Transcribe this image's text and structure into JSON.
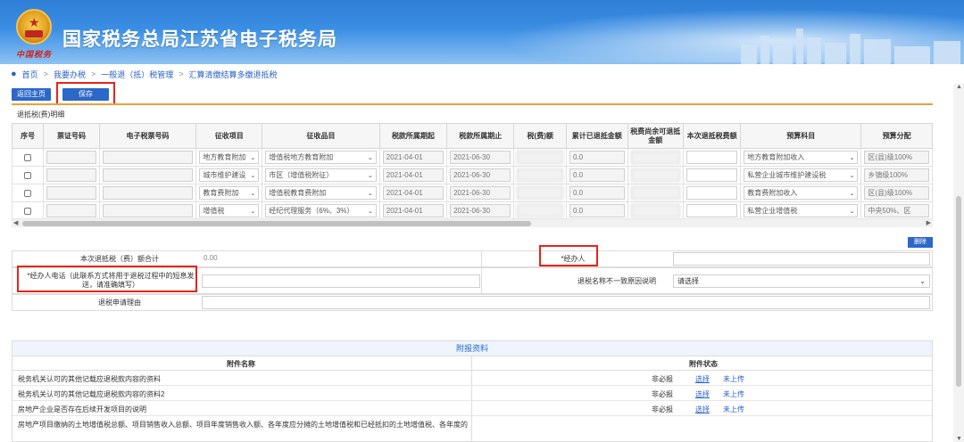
{
  "header": {
    "site_title": "国家税务总局江苏省电子税务局",
    "emblem_caption": "中国税务"
  },
  "breadcrumb": {
    "items": [
      "首页",
      "我要办税",
      "一般退（抵）税管理",
      "汇算清缴结算多缴退抵税"
    ],
    "separator": ">"
  },
  "toolbar": {
    "home_label": "返回主页",
    "save_label": "保存"
  },
  "refund_table": {
    "section_title": "退抵税(费)明细",
    "columns": [
      "序号",
      "票证号码",
      "电子税票号码",
      "征收项目",
      "征收品目",
      "税款所属期起",
      "税款所属期止",
      "税(费)额",
      "累计已退抵金额",
      "税费尚余可退抵金额",
      "本次退抵税费额",
      "预算科目",
      "预算分配"
    ],
    "rows": [
      {
        "item": "地方教育附加",
        "subitem": "增值税地方教育附加",
        "start": "2021-04-01",
        "end": "2021-06-30",
        "refunded": "0.0",
        "budget": "地方教育附加收入",
        "alloc": "区(县)级100%"
      },
      {
        "item": "城市维护建设",
        "subitem": "市区（增值税附征）",
        "start": "2021-04-01",
        "end": "2021-06-30",
        "refunded": "0.0",
        "budget": "私营企业城市维护建设税",
        "alloc": "乡镇级100%"
      },
      {
        "item": "教育费附加",
        "subitem": "增值税教育费附加",
        "start": "2021-04-01",
        "end": "2021-06-30",
        "refunded": "0.0",
        "budget": "教育费附加收入",
        "alloc": "区(县)级100%"
      },
      {
        "item": "增值税",
        "subitem": "经纪代理服务（6%、3%）",
        "start": "2021-04-01",
        "end": "2021-06-30",
        "refunded": "0.0",
        "budget": "私营企业增值税",
        "alloc": "中央50%、区"
      }
    ]
  },
  "delete_label": "删除",
  "form": {
    "total_label": "本次退抵税（费）额合计",
    "total_value": "0.00",
    "handler_label": "*经办人",
    "phone_label": "*经办人电话（此联系方式将用于退税过程中的短息发送，请准确填写）",
    "name_mismatch_label": "退税名称不一致原因说明",
    "name_mismatch_value": "请选择",
    "reason_label": "退税申请理由"
  },
  "attachments": {
    "title": "附报资料",
    "col_name": "附件名称",
    "col_status": "附件状态",
    "rows": [
      {
        "name": "税务机关认可的其他记载应退税款内容的资料",
        "required": "非必报",
        "select": "选择",
        "status": "未上传"
      },
      {
        "name": "税务机关认可的其他记载应退税款内容的资料2",
        "required": "非必报",
        "select": "选择",
        "status": "未上传"
      },
      {
        "name": "房地产企业是否存在后续开发项目的说明",
        "required": "非必报",
        "select": "选择",
        "status": "未上传"
      },
      {
        "name": "房地产项目缴纳的土地增值税总额、项目销售收入总额、项目年度销售收入额、各年度应分摊的土地增值税和已经抵扣的土地增值税、各年度的",
        "required": "",
        "select": "",
        "status": ""
      }
    ]
  }
}
